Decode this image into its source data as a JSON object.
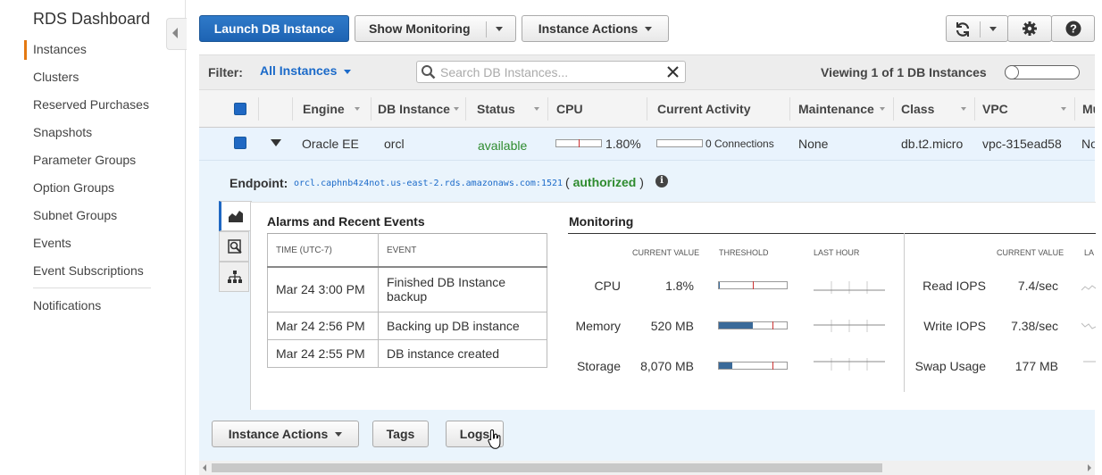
{
  "sidebar": {
    "title": "RDS Dashboard",
    "items": [
      "Instances",
      "Clusters",
      "Reserved Purchases",
      "Snapshots",
      "Parameter Groups",
      "Option Groups",
      "Subnet Groups",
      "Events",
      "Event Subscriptions",
      "Notifications"
    ],
    "active": "Instances"
  },
  "toolbar": {
    "launch_label": "Launch DB Instance",
    "monitoring_label": "Show Monitoring",
    "actions_label": "Instance Actions"
  },
  "filter": {
    "label": "Filter:",
    "value": "All Instances",
    "search_placeholder": "Search DB Instances...",
    "viewing": "Viewing 1 of 1 DB Instances"
  },
  "table": {
    "columns": [
      "Engine",
      "DB Instance",
      "Status",
      "CPU",
      "Current Activity",
      "Maintenance",
      "Class",
      "VPC",
      "Mu"
    ],
    "row": {
      "engine": "Oracle EE",
      "db_instance": "orcl",
      "status": "available",
      "cpu": "1.80%",
      "cpu_fraction": 0.018,
      "activity": "0 Connections",
      "maintenance": "None",
      "class": "db.t2.micro",
      "vpc": "vpc-315ead58",
      "multi_az": "No"
    }
  },
  "detail": {
    "endpoint_label": "Endpoint:",
    "endpoint_value": "orcl.caphnb4z4not.us-east-2.rds.amazonaws.com:1521",
    "auth_open": "(",
    "auth_text": "authorized",
    "auth_close": ")",
    "alarms_title": "Alarms and Recent Events",
    "alarms_headers": [
      "TIME (UTC-7)",
      "EVENT"
    ],
    "events": [
      {
        "time": "Mar 24 3:00 PM",
        "event": "Finished DB Instance backup"
      },
      {
        "time": "Mar 24 2:56 PM",
        "event": "Backing up DB instance"
      },
      {
        "time": "Mar 24 2:55 PM",
        "event": "DB instance created"
      }
    ],
    "monitoring_title": "Monitoring",
    "monitoring_headers": {
      "current": "CURRENT VALUE",
      "threshold": "THRESHOLD",
      "last_hour": "LAST HOUR",
      "right_last": "LA"
    },
    "metrics_left": [
      {
        "name": "CPU",
        "value": "1.8%",
        "fill": 0.018
      },
      {
        "name": "Memory",
        "value": "520 MB",
        "fill": 0.5
      },
      {
        "name": "Storage",
        "value": "8,070 MB",
        "fill": 0.2
      }
    ],
    "metrics_right": [
      {
        "name": "Read IOPS",
        "value": "7.4/sec"
      },
      {
        "name": "Write IOPS",
        "value": "7.38/sec"
      },
      {
        "name": "Swap Usage",
        "value": "177 MB"
      }
    ]
  },
  "bottom": {
    "actions_label": "Instance Actions",
    "tags_label": "Tags",
    "logs_label": "Logs"
  },
  "colors": {
    "accent": "#1f68c3",
    "active_nav": "#e47911",
    "status_ok": "#2e8b2e"
  }
}
